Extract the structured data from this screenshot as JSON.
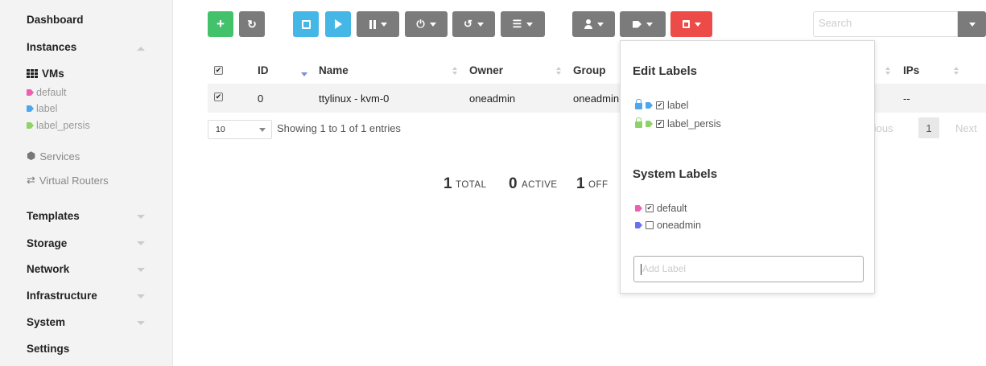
{
  "sidebar": {
    "dashboard": "Dashboard",
    "instances": "Instances",
    "vms": "VMs",
    "labels": [
      "default",
      "label",
      "label_persis"
    ],
    "services": "Services",
    "virtual_routers": "Virtual Routers",
    "templates": "Templates",
    "storage": "Storage",
    "network": "Network",
    "infrastructure": "Infrastructure",
    "system": "System",
    "settings": "Settings"
  },
  "toolbar": {
    "create_icon": "plus-icon",
    "refresh_icon": "refresh-icon",
    "save_icon": "floppy-icon",
    "play_icon": "play-icon",
    "pause_icon": "pause-icon",
    "power_icon": "power-icon",
    "reboot_icon": "reboot-icon",
    "list_icon": "list-icon",
    "user_icon": "user-icon",
    "tag_icon": "tag-icon",
    "trash_icon": "trash-icon"
  },
  "search": {
    "placeholder": "Search"
  },
  "table": {
    "headers": {
      "id": "ID",
      "name": "Name",
      "owner": "Owner",
      "group": "Group",
      "ips": "IPs"
    },
    "row": {
      "id": "0",
      "name": "ttylinux - kvm-0",
      "owner": "oneadmin",
      "group": "oneadmin",
      "ips": "--"
    },
    "page_length": "10",
    "showing": "Showing 1 to 1 of 1 entries",
    "pagination": {
      "previous": "Previous",
      "current": "1",
      "next": "Next"
    }
  },
  "stats": {
    "total_num": "1",
    "total_label": "TOTAL",
    "active_num": "0",
    "active_label": "ACTIVE",
    "off_num": "1",
    "off_label": "OFF"
  },
  "labels_dropdown": {
    "edit_title": "Edit Labels",
    "edit_labels": [
      "label",
      "label_persis"
    ],
    "system_title": "System Labels",
    "system_labels": [
      "default",
      "oneadmin"
    ],
    "add_placeholder": "Add Label"
  },
  "colors": {
    "green": "#43c26b",
    "blue": "#45b7e6",
    "grey": "#7b7b7b",
    "red": "#ec4b47",
    "tag_pink": "#ee5fb0",
    "tag_blue": "#4da7ee",
    "tag_green": "#8fd16b",
    "tag_purple": "#6b6ff0"
  }
}
